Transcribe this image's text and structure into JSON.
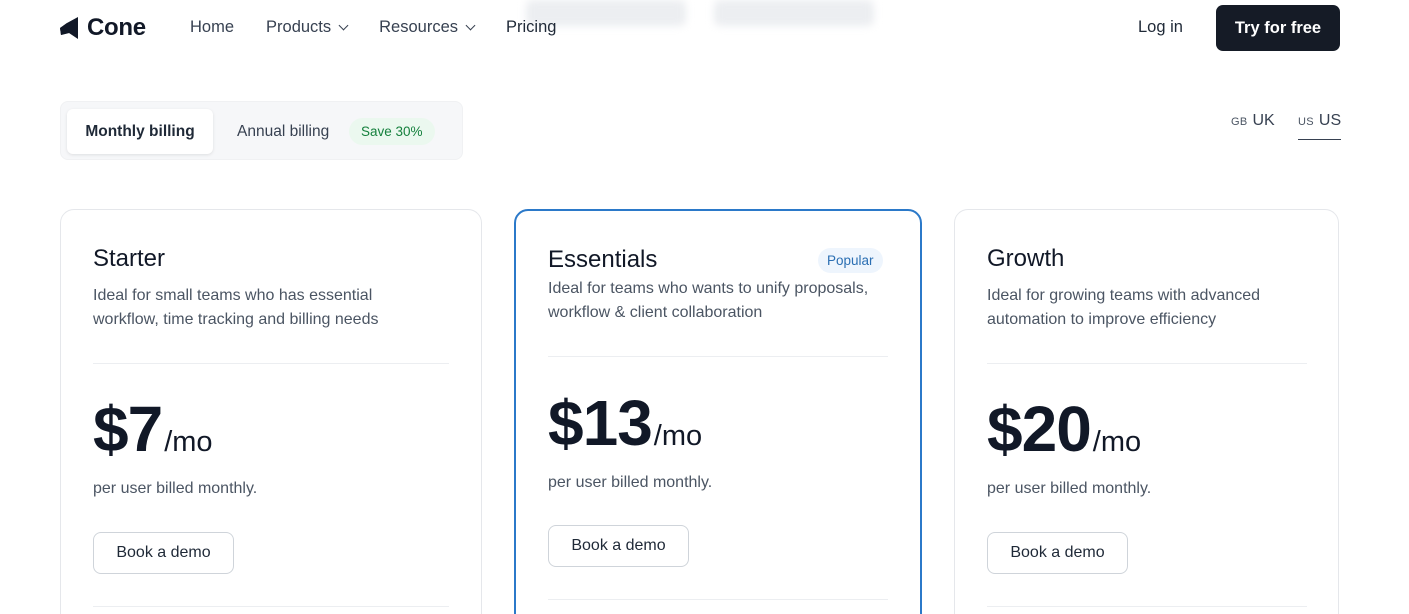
{
  "nav": {
    "logo_text": "Cone",
    "links": [
      {
        "label": "Home"
      },
      {
        "label": "Products"
      },
      {
        "label": "Resources"
      },
      {
        "label": "Pricing"
      }
    ],
    "login_label": "Log in",
    "cta_label": "Try for free"
  },
  "billing": {
    "monthly_label": "Monthly billing",
    "annual_label": "Annual billing",
    "save_badge": "Save 30%",
    "selected": "monthly"
  },
  "region": {
    "options": [
      {
        "code": "GB",
        "label": "UK"
      },
      {
        "code": "US",
        "label": "US"
      }
    ],
    "selected": "US"
  },
  "plans": [
    {
      "name": "Starter",
      "description": "Ideal for small teams who has essential workflow, time tracking and billing needs",
      "price": "$7",
      "unit": "/mo",
      "price_note": "per user billed monthly.",
      "button_label": "Book a demo"
    },
    {
      "name": "Essentials",
      "badge": "Popular",
      "description": "Ideal for teams who wants to unify proposals, workflow & client collaboration",
      "price": "$13",
      "unit": "/mo",
      "price_note": "per user billed monthly.",
      "button_label": "Book a demo"
    },
    {
      "name": "Growth",
      "description": "Ideal for growing teams with advanced automation to improve efficiency",
      "price": "$20",
      "unit": "/mo",
      "price_note": "per user billed monthly.",
      "button_label": "Book a demo"
    }
  ],
  "colors": {
    "accent_border": "#2b79c9",
    "cta_bg": "#151b26",
    "save_green": "#15803d",
    "popular_blue": "#2b6fb3"
  }
}
